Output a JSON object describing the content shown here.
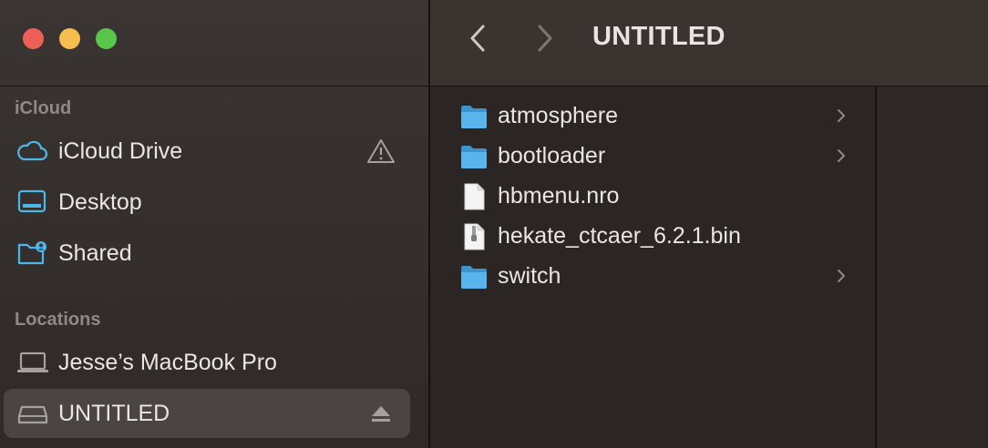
{
  "window": {
    "title": "UNTITLED"
  },
  "sidebar": {
    "sections": [
      {
        "header": "iCloud",
        "items": [
          {
            "label": "iCloud Drive",
            "icon": "cloud-icon",
            "trailing_icon": "warning-icon"
          },
          {
            "label": "Desktop",
            "icon": "desktop-icon"
          },
          {
            "label": "Shared",
            "icon": "shared-folder-icon"
          }
        ]
      },
      {
        "header": "Locations",
        "items": [
          {
            "label": "Jesse’s MacBook Pro",
            "icon": "laptop-icon"
          },
          {
            "label": "UNTITLED",
            "icon": "drive-icon",
            "trailing_icon": "eject-icon",
            "selected": true
          }
        ]
      }
    ]
  },
  "files": [
    {
      "name": "atmosphere",
      "type": "folder",
      "has_children": true
    },
    {
      "name": "bootloader",
      "type": "folder",
      "has_children": true
    },
    {
      "name": "hbmenu.nro",
      "type": "document",
      "has_children": false
    },
    {
      "name": "hekate_ctcaer_6.2.1.bin",
      "type": "binary",
      "has_children": false
    },
    {
      "name": "switch",
      "type": "folder",
      "has_children": true
    }
  ],
  "colors": {
    "accent": "#4cb8e8",
    "folder": "#4fa9e3",
    "close": "#ee5f58",
    "minimize": "#f6be4f",
    "zoom": "#58c64a"
  }
}
